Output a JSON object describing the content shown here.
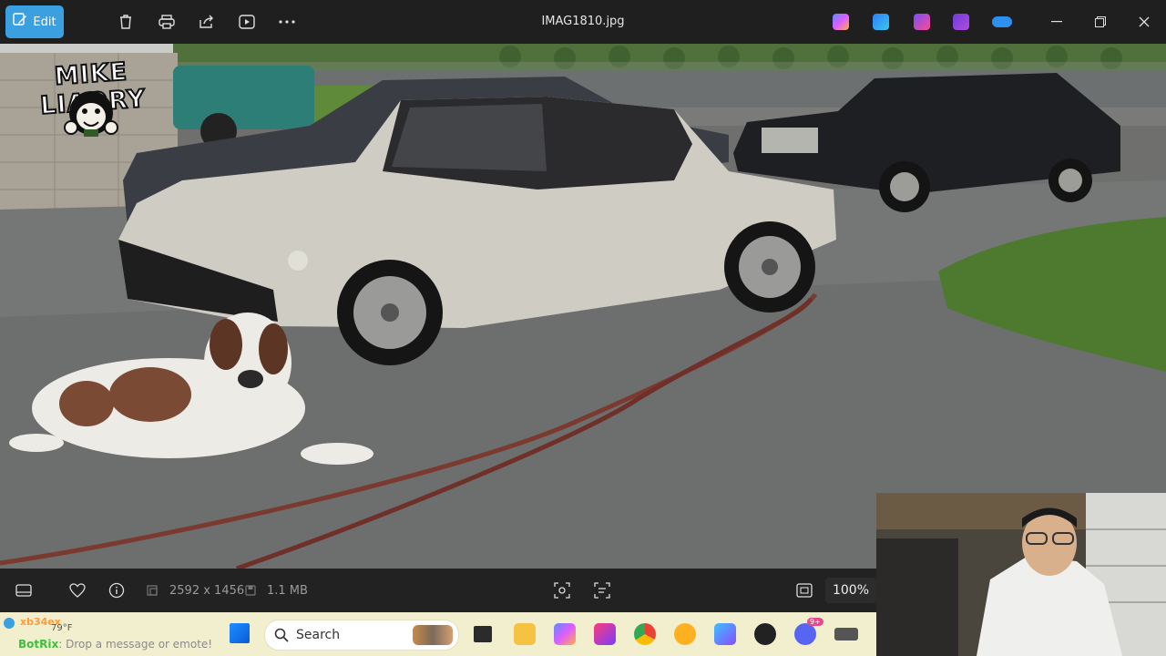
{
  "titlebar": {
    "edit_label": "Edit",
    "file_name": "IMAG1810.jpg",
    "toolbar_icons": [
      "edit-icon",
      "delete-icon",
      "print-icon",
      "share-icon",
      "slideshow-icon",
      "more-icon"
    ],
    "app_icons": [
      "copilot-icon",
      "designer-icon",
      "clipchamp-icon",
      "video-editor-icon",
      "onedrive-icon"
    ],
    "window_buttons": [
      "minimize-icon",
      "restore-icon",
      "close-icon"
    ]
  },
  "overlay": {
    "logo_text": "MIKE LIAORY"
  },
  "infobar": {
    "dimensions": "2592 x 1456",
    "file_size": "1.1 MB",
    "zoom": "100%"
  },
  "taskbar": {
    "search_placeholder": "Search",
    "pinned_icons": [
      "windows-start-icon",
      "search-icon",
      "task-view-icon",
      "file-explorer-icon",
      "copilot-icon",
      "picsart-icon",
      "chrome-icon",
      "sun-app-icon",
      "gem-app-icon",
      "obs-icon",
      "discord-icon",
      "stream-icon"
    ],
    "discord_badge": "9+"
  },
  "chat": {
    "user": "xb34ex",
    "temperature": "79°F",
    "bot_name": "BotRix",
    "prompt": "Drop a message or emote!"
  },
  "colors": {
    "edit_accent": "#3aa0e0",
    "taskbar_bg": "#f2efcf",
    "titlebar_bg": "#1f1f1f"
  }
}
